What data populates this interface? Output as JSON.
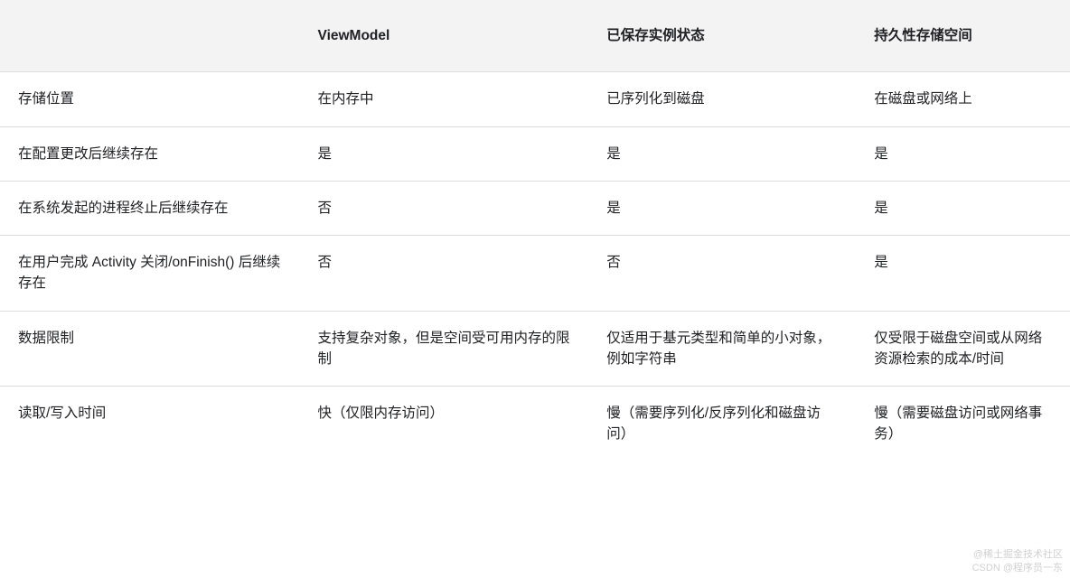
{
  "chart_data": {
    "type": "table",
    "headers": [
      "",
      "ViewModel",
      "已保存实例状态",
      "持久性存储空间"
    ],
    "rows": [
      [
        "存储位置",
        "在内存中",
        "已序列化到磁盘",
        "在磁盘或网络上"
      ],
      [
        "在配置更改后继续存在",
        "是",
        "是",
        "是"
      ],
      [
        "在系统发起的进程终止后继续存在",
        "否",
        "是",
        "是"
      ],
      [
        "在用户完成 Activity 关闭/onFinish() 后继续存在",
        "否",
        "否",
        "是"
      ],
      [
        "数据限制",
        "支持复杂对象，但是空间受可用内存的限制",
        "仅适用于基元类型和简单的小对象，例如字符串",
        "仅受限于磁盘空间或从网络资源检索的成本/时间"
      ],
      [
        "读取/写入时间",
        "快（仅限内存访问）",
        "慢（需要序列化/反序列化和磁盘访问）",
        "慢（需要磁盘访问或网络事务）"
      ]
    ]
  },
  "watermark": {
    "line1": "@稀土掘金技术社区",
    "line2": "CSDN @程序员一东"
  }
}
